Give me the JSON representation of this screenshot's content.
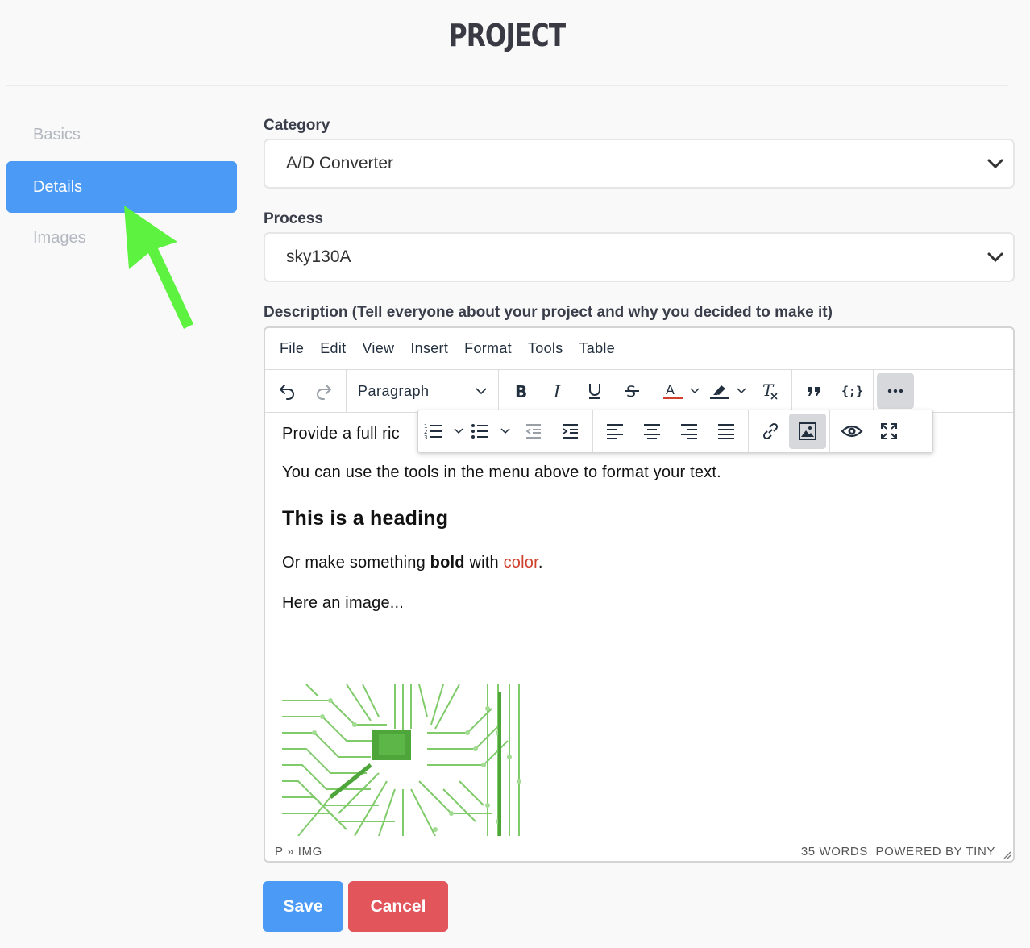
{
  "page": {
    "title": "PROJECT"
  },
  "sidebar": {
    "items": [
      {
        "label": "Basics",
        "active": false
      },
      {
        "label": "Details",
        "active": true
      },
      {
        "label": "Images",
        "active": false
      }
    ]
  },
  "form": {
    "category": {
      "label": "Category",
      "value": "A/D Converter"
    },
    "process": {
      "label": "Process",
      "value": "sky130A"
    },
    "description": {
      "label": "Description (Tell everyone about your project and why you decided to make it)"
    }
  },
  "editor": {
    "menu": [
      "File",
      "Edit",
      "View",
      "Insert",
      "Format",
      "Tools",
      "Table"
    ],
    "block_format": "Paragraph",
    "content": {
      "line1": "Provide a full ric",
      "line2": "You can use the tools in the menu above to format your text.",
      "heading": "This is a heading",
      "line3_pre": "Or make something ",
      "line3_bold": "bold",
      "line3_mid": " with ",
      "line3_color": "color",
      "line3_end": ".",
      "line4": "Here an image..."
    },
    "status": {
      "path": "P » IMG",
      "words": "35 WORDS",
      "powered": "POWERED BY TINY"
    },
    "colors": {
      "text_color_bar": "#d0402c",
      "highlight_bar": "#222f3e"
    }
  },
  "actions": {
    "save": "Save",
    "cancel": "Cancel"
  },
  "colors": {
    "primary": "#4b9af5",
    "danger": "#e2555a",
    "annotation_arrow": "#5df23f"
  }
}
